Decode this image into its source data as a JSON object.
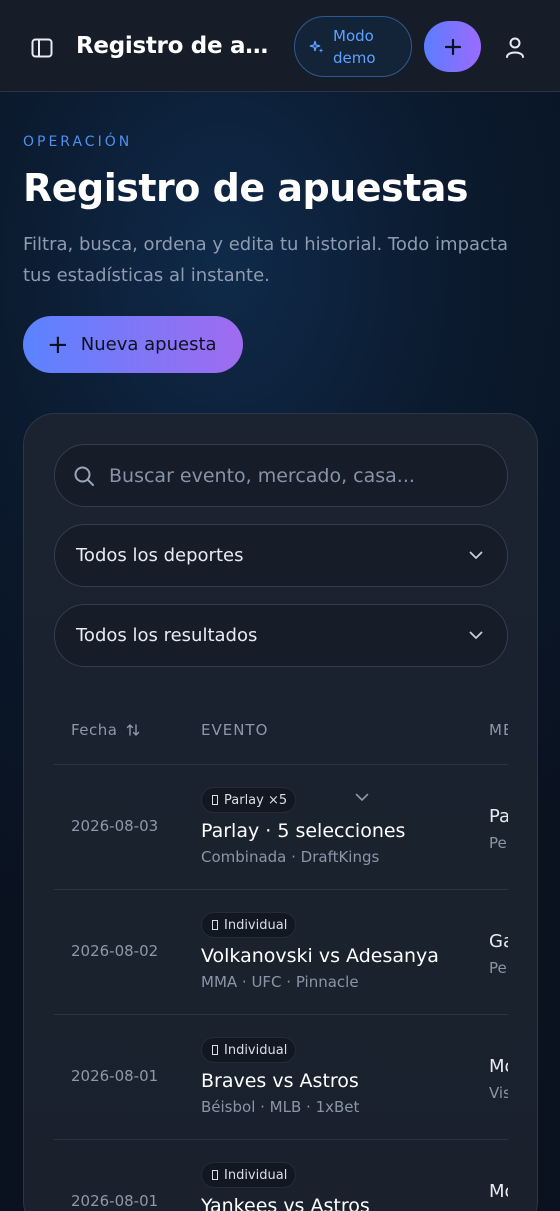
{
  "header": {
    "title": "Registro de apuestas",
    "demo_label": "Modo demo"
  },
  "hero": {
    "eyebrow": "OPERACIÓN",
    "title": "Registro de apuestas",
    "subtitle": "Filtra, busca, ordena y edita tu historial. Todo impacta tus estadísticas al instante.",
    "new_bet_label": "Nueva apuesta"
  },
  "filters": {
    "search_placeholder": "Buscar evento, mercado, casa...",
    "sport_selected": "Todos los deportes",
    "result_selected": "Todos los resultados"
  },
  "table": {
    "columns": {
      "date": "Fecha",
      "event": "EVENTO",
      "market": "MERCADO"
    },
    "rows": [
      {
        "date": "2026-08-03",
        "badge": "Parlay ×5",
        "event": "Parlay · 5 selecciones",
        "meta": "Combinada · DraftKings",
        "market": "Parlay",
        "market_sub": "Pe"
      },
      {
        "date": "2026-08-02",
        "badge": "Individual",
        "event": "Volkanovski vs Adesanya",
        "meta": "MMA · UFC · Pinnacle",
        "market": "Ga",
        "market_sub": "Pe"
      },
      {
        "date": "2026-08-01",
        "badge": "Individual",
        "event": "Braves vs Astros",
        "meta": "Béisbol · MLB · 1xBet",
        "market": "Mo",
        "market_sub": "Vis"
      },
      {
        "date": "2026-08-01",
        "badge": "Individual",
        "event": "Yankees vs Astros",
        "meta": "",
        "market": "Mo",
        "market_sub": ""
      }
    ]
  },
  "colors": {
    "accent": "#5b83ff",
    "accent2": "#a06bf0",
    "eyebrow": "#4f8ff0"
  }
}
